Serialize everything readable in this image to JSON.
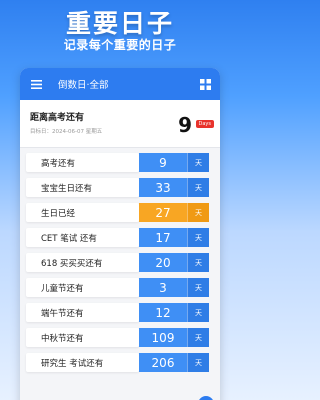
{
  "promo": {
    "title": "重要日子",
    "subtitle": "记录每个重要的日子"
  },
  "appbar": {
    "title": "倒数日·全部",
    "menu_icon": "menu-icon",
    "view_icon": "grid-view-icon"
  },
  "hero": {
    "title": "距离高考还有",
    "subtitle": "目标日：2024-06-07 星期五",
    "days": "9",
    "badge": "Days"
  },
  "colors": {
    "primary": "#2d7cf0",
    "future_cell": "#3f8ff5",
    "past_cell": "#f8a623",
    "badge": "#e8332c"
  },
  "events": [
    {
      "label": "高考还有",
      "days": "9",
      "unit": "天",
      "status": "future"
    },
    {
      "label": "宝宝生日还有",
      "days": "33",
      "unit": "天",
      "status": "future"
    },
    {
      "label": "生日已经",
      "days": "27",
      "unit": "天",
      "status": "past"
    },
    {
      "label": "CET 笔试 还有",
      "days": "17",
      "unit": "天",
      "status": "future"
    },
    {
      "label": "618 买买买还有",
      "days": "20",
      "unit": "天",
      "status": "future"
    },
    {
      "label": "儿童节还有",
      "days": "3",
      "unit": "天",
      "status": "future"
    },
    {
      "label": "端午节还有",
      "days": "12",
      "unit": "天",
      "status": "future"
    },
    {
      "label": "中秋节还有",
      "days": "109",
      "unit": "天",
      "status": "future"
    },
    {
      "label": "研究生 考试还有",
      "days": "206",
      "unit": "天",
      "status": "future"
    }
  ],
  "fab": {
    "label": "+",
    "icon": "add-icon"
  }
}
